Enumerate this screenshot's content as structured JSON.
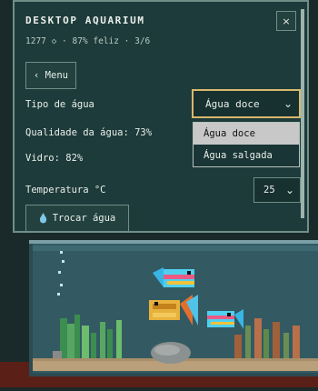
{
  "panel": {
    "title": "DESKTOP AQUARIUM",
    "subtitle": "1277 ◇ · 87% feliz · 3/6",
    "close_label": "×",
    "menu_label": "‹ Menu",
    "water_type_label": "Tipo de água",
    "water_type_value": "Água doce",
    "water_type_options": [
      "Água doce",
      "Água salgada"
    ],
    "quality_label": "Qualidade da água: 73%",
    "glass_label": "Vidro: 82%",
    "temperature_label": "Temperatura °C",
    "temperature_value": "25",
    "swap_water_label": "Trocar água"
  },
  "icons": {
    "close": "close-icon",
    "chevron": "chevron-down-icon",
    "water_drop": "water-drop-icon"
  },
  "colors": {
    "panel_bg": "#1e3b3b",
    "focus_border": "#d7b86c",
    "selected_option": "#c8c8c8"
  }
}
